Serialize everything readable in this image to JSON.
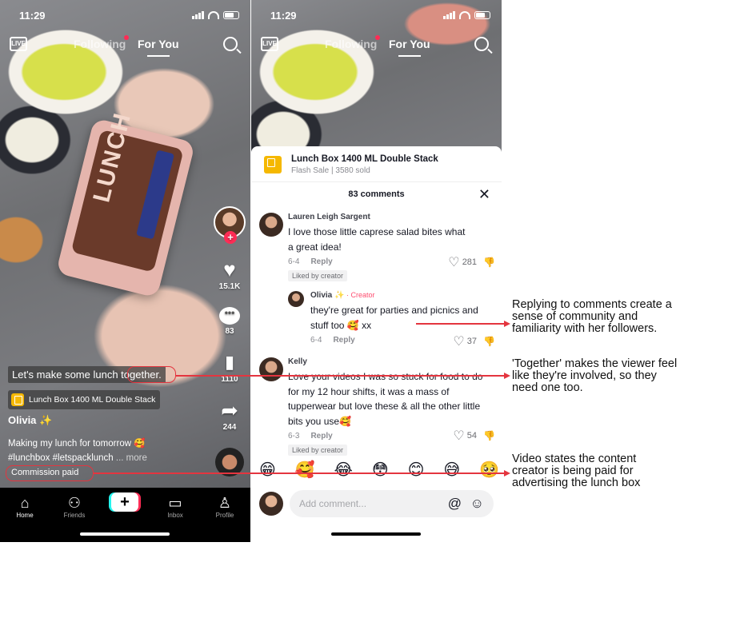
{
  "status": {
    "time": "11:29"
  },
  "left": {
    "live": "LIVE",
    "tabs": {
      "following": "Following",
      "foryou": "For You"
    },
    "counts": {
      "likes": "15.1K",
      "comments": "83",
      "saves": "1110",
      "shares": "244"
    },
    "bubble": "•••",
    "caption": "Let's make some lunch together.",
    "product_tag": "Lunch Box 1400 ML Double Stack",
    "username": "Olivia ✨",
    "desc_line1": "Making my lunch for tomorrow 🥰",
    "desc_line2": "#lunchbox #letspacklunch",
    "more": "... more",
    "commission": "Commission paid",
    "lunchbox_text": "LUNCH",
    "nav": {
      "home": "Home",
      "friends": "Friends",
      "inbox": "Inbox",
      "profile": "Profile",
      "create": "+"
    }
  },
  "right": {
    "product_title": "Lunch Box 1400 ML Double Stack",
    "product_sub": "Flash Sale | 3580 sold",
    "comments_count": "83 comments",
    "close": "✕",
    "comments": [
      {
        "name": "Lauren Leigh Sargent",
        "text": "I love those little caprese salad bites what a great idea!",
        "date": "6-4",
        "reply": "Reply",
        "likes": "281",
        "liked": "Liked by creator"
      },
      {
        "name": "Olivia ✨",
        "creator": " · Creator",
        "text": "they're great for parties and picnics and stuff too 🥰 xx",
        "date": "6-4",
        "reply": "Reply",
        "likes": "37"
      },
      {
        "name": "Kelly",
        "text": "Love your videos I was so stuck for food to do for my 12 hour shifts, it was a mass of tupperwear but love these & all the other little bits you use🥰",
        "date": "6-3",
        "reply": "Reply",
        "likes": "54",
        "liked": "Liked by creator"
      }
    ],
    "emojis": [
      "😁",
      "🥰",
      "😂",
      "😳",
      "😊",
      "😅",
      "🥺"
    ],
    "placeholder": "Add comment...",
    "at": "@",
    "smile": "☺"
  },
  "annotations": {
    "a1": "Replying to comments create a sense of community and familiarity with her followers.",
    "a2": "'Together' makes the viewer feel like they're involved, so they need one too.",
    "a3": "Video states the content creator is being paid for advertising the lunch box"
  },
  "colors": {
    "accent": "#fe2c55",
    "annotation": "#e4353f",
    "shop": "#f5b800"
  }
}
